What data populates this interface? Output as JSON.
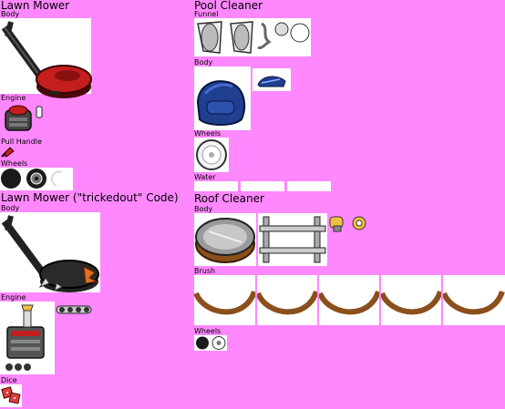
{
  "sheet": {
    "background": "#ff88ff",
    "sections": {
      "lawn_mower": {
        "title": "Lawn Mower",
        "body_label": "Body",
        "engine_label": "Engine",
        "pull_handle_label": "Pull Handle",
        "wheels_label": "Wheels"
      },
      "lawn_mower_trickedout": {
        "title": "Lawn Mower (\"trickedout\" Code)",
        "body_label": "Body",
        "engine_label": "Engine",
        "dice_label": "Dice"
      },
      "pool_cleaner": {
        "title": "Pool Cleaner",
        "funnel_label": "Funnel",
        "body_label": "Body",
        "wheels_label": "Wheels",
        "water_label": "Water"
      },
      "roof_cleaner": {
        "title": "Roof Cleaner",
        "body_label": "Body",
        "brush_label": "Brush",
        "wheels_label": "Wheels"
      }
    },
    "colors": {
      "mower_red": "#c41e1e",
      "pool_blue": "#1f3f8f",
      "metal_gray": "#9a9a9a",
      "brush_brown": "#8b4f1c"
    }
  }
}
